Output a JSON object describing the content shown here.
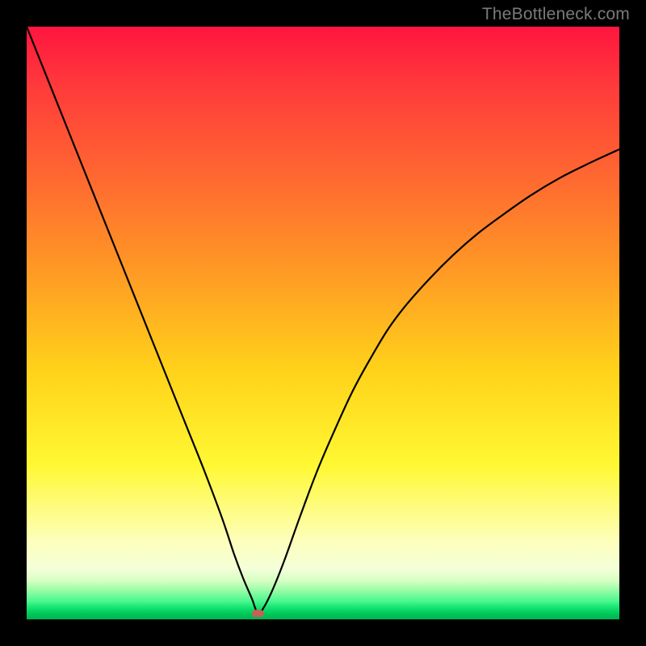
{
  "watermark": "TheBottleneck.com",
  "chart_data": {
    "type": "line",
    "title": "",
    "xlabel": "",
    "ylabel": "",
    "xlim": [
      0,
      100
    ],
    "ylim": [
      0,
      100
    ],
    "grid": false,
    "marker": {
      "x": 39,
      "y": 1,
      "color": "#c86058"
    },
    "background_gradient": {
      "direction": "vertical",
      "stops": [
        {
          "pos": 0,
          "color": "#ff153f"
        },
        {
          "pos": 0.42,
          "color": "#ff9c24"
        },
        {
          "pos": 0.74,
          "color": "#fff833"
        },
        {
          "pos": 0.93,
          "color": "#d6ffc2"
        },
        {
          "pos": 1.0,
          "color": "#00b24f"
        }
      ]
    },
    "series": [
      {
        "name": "curve",
        "x": [
          0,
          3,
          6,
          9,
          12,
          15,
          18,
          21,
          24,
          27,
          30,
          33,
          35,
          36.5,
          38,
          39,
          40,
          41.5,
          43.5,
          46,
          49,
          52,
          55,
          58,
          61,
          64,
          68,
          72,
          76,
          80,
          85,
          90,
          95,
          100
        ],
        "y": [
          100,
          92.5,
          85,
          77.5,
          70,
          62.5,
          55,
          47.5,
          40,
          32.5,
          25,
          17,
          11,
          7,
          3.5,
          1,
          2,
          5,
          10,
          17,
          25,
          32,
          38.5,
          44,
          49,
          53,
          57.5,
          61.5,
          65,
          68,
          71.5,
          74.5,
          77,
          79.3
        ]
      }
    ]
  }
}
